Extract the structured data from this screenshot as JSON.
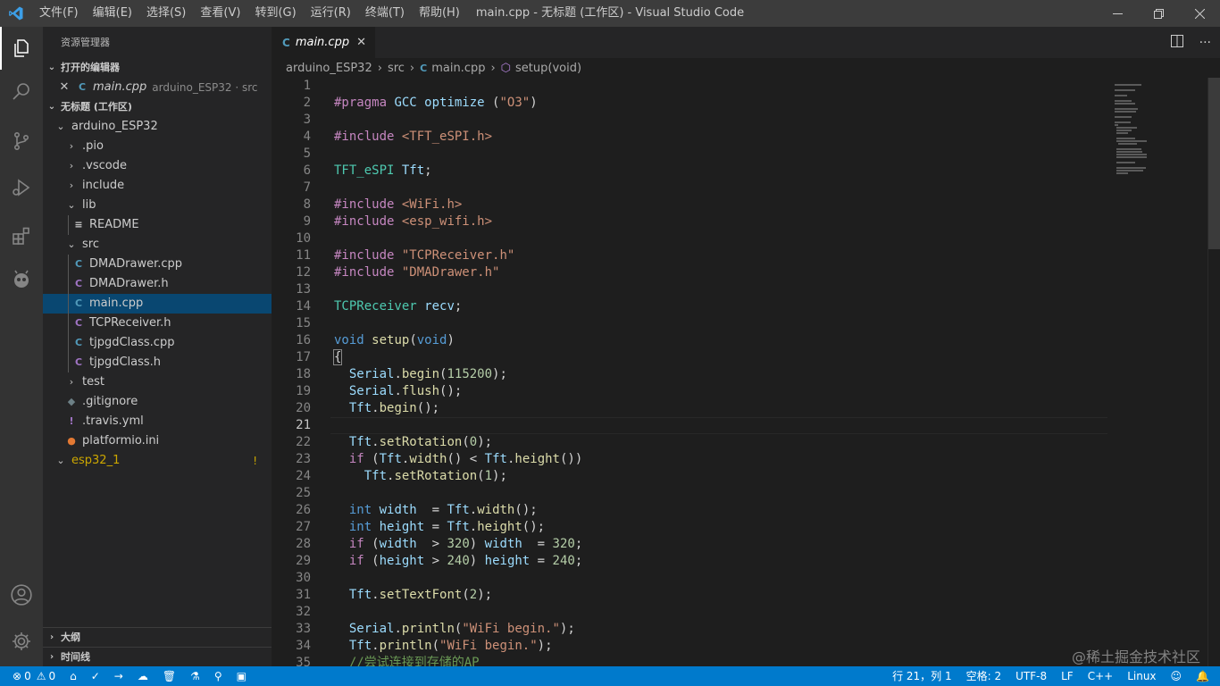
{
  "window": {
    "title": "main.cpp - 无标题 (工作区) - Visual Studio Code",
    "menu": [
      "文件(F)",
      "编辑(E)",
      "选择(S)",
      "查看(V)",
      "转到(G)",
      "运行(R)",
      "终端(T)",
      "帮助(H)"
    ]
  },
  "sidebar": {
    "title": "资源管理器",
    "open_editors_header": "打开的编辑器",
    "open_editor": {
      "name": "main.cpp",
      "desc": "arduino_ESP32 · src"
    },
    "workspace_header": "无标题 (工作区)",
    "tree": [
      {
        "label": "arduino_ESP32",
        "twisty": "⌄",
        "icon": "",
        "depth": 0
      },
      {
        "label": ".pio",
        "twisty": "›",
        "icon": "",
        "depth": 1
      },
      {
        "label": ".vscode",
        "twisty": "›",
        "icon": "",
        "depth": 1
      },
      {
        "label": "include",
        "twisty": "›",
        "icon": "",
        "depth": 1
      },
      {
        "label": "lib",
        "twisty": "⌄",
        "icon": "",
        "depth": 1
      },
      {
        "label": "README",
        "twisty": "",
        "icon": "≡",
        "depth": 2
      },
      {
        "label": "src",
        "twisty": "⌄",
        "icon": "",
        "depth": 1
      },
      {
        "label": "DMADrawer.cpp",
        "twisty": "",
        "icon": "C",
        "depth": 2
      },
      {
        "label": "DMADrawer.h",
        "twisty": "",
        "icon": "C",
        "depth": 2
      },
      {
        "label": "main.cpp",
        "twisty": "",
        "icon": "C",
        "depth": 2
      },
      {
        "label": "TCPReceiver.h",
        "twisty": "",
        "icon": "C",
        "depth": 2
      },
      {
        "label": "tjpgdClass.cpp",
        "twisty": "",
        "icon": "C",
        "depth": 2
      },
      {
        "label": "tjpgdClass.h",
        "twisty": "",
        "icon": "C",
        "depth": 2
      },
      {
        "label": "test",
        "twisty": "›",
        "icon": "",
        "depth": 1
      },
      {
        "label": ".gitignore",
        "twisty": "",
        "icon": "◆",
        "depth": 1
      },
      {
        "label": ".travis.yml",
        "twisty": "",
        "icon": "!",
        "depth": 1
      },
      {
        "label": "platformio.ini",
        "twisty": "",
        "icon": "●",
        "depth": 1
      },
      {
        "label": "esp32_1",
        "twisty": "⌄",
        "icon": "",
        "depth": 0,
        "badge": "!"
      }
    ],
    "outline_header": "大纲",
    "timeline_header": "时间线"
  },
  "editor": {
    "tab_label": "main.cpp",
    "breadcrumb": [
      "arduino_ESP32",
      "src",
      "main.cpp",
      "setup(void)"
    ],
    "lines": [
      {
        "n": "1",
        "code": ""
      },
      {
        "n": "2",
        "code": "#pragma GCC optimize (\"O3\")"
      },
      {
        "n": "3",
        "code": ""
      },
      {
        "n": "4",
        "code": "#include <TFT_eSPI.h>"
      },
      {
        "n": "5",
        "code": ""
      },
      {
        "n": "6",
        "code": "TFT_eSPI Tft;"
      },
      {
        "n": "7",
        "code": ""
      },
      {
        "n": "8",
        "code": "#include <WiFi.h>"
      },
      {
        "n": "9",
        "code": "#include <esp_wifi.h>"
      },
      {
        "n": "10",
        "code": ""
      },
      {
        "n": "11",
        "code": "#include \"TCPReceiver.h\""
      },
      {
        "n": "12",
        "code": "#include \"DMADrawer.h\""
      },
      {
        "n": "13",
        "code": ""
      },
      {
        "n": "14",
        "code": "TCPReceiver recv;"
      },
      {
        "n": "15",
        "code": ""
      },
      {
        "n": "16",
        "code": "void setup(void)"
      },
      {
        "n": "17",
        "code": "{"
      },
      {
        "n": "18",
        "code": "  Serial.begin(115200);"
      },
      {
        "n": "19",
        "code": "  Serial.flush();"
      },
      {
        "n": "20",
        "code": "  Tft.begin();"
      },
      {
        "n": "21",
        "code": ""
      },
      {
        "n": "22",
        "code": "  Tft.setRotation(0);"
      },
      {
        "n": "23",
        "code": "  if (Tft.width() < Tft.height())"
      },
      {
        "n": "24",
        "code": "    Tft.setRotation(1);"
      },
      {
        "n": "25",
        "code": ""
      },
      {
        "n": "26",
        "code": "  int width  = Tft.width();"
      },
      {
        "n": "27",
        "code": "  int height = Tft.height();"
      },
      {
        "n": "28",
        "code": "  if (width  > 320) width  = 320;"
      },
      {
        "n": "29",
        "code": "  if (height > 240) height = 240;"
      },
      {
        "n": "30",
        "code": ""
      },
      {
        "n": "31",
        "code": "  Tft.setTextFont(2);"
      },
      {
        "n": "32",
        "code": ""
      },
      {
        "n": "33",
        "code": "  Serial.println(\"WiFi begin.\");"
      },
      {
        "n": "34",
        "code": "  Tft.println(\"WiFi begin.\");"
      },
      {
        "n": "35",
        "code": "  //尝试连接到存储的AP"
      }
    ]
  },
  "statusbar": {
    "errors": "0",
    "warnings": "0",
    "position": "行 21，列 1",
    "spaces": "空格: 2",
    "encoding": "UTF-8",
    "eol": "LF",
    "language": "C++",
    "platform": "Linux"
  },
  "watermark": "@稀土掘金技术社区",
  "colors": {
    "accent": "#007acc",
    "selection": "#094771",
    "cpp_icon": "#519aba",
    "h_icon": "#a074c4"
  }
}
